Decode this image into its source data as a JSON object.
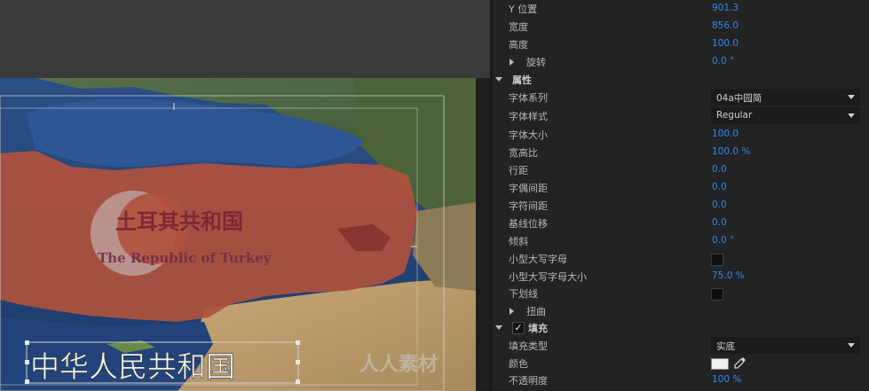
{
  "watermark": "人人素材",
  "map": {
    "title_cn": "土耳其共和国",
    "title_en": "The Republic of Turkey",
    "caption": "中华人民共和国"
  },
  "properties": {
    "y_position": {
      "label": "Y 位置",
      "value": "901.3"
    },
    "width": {
      "label": "宽度",
      "value": "856.0"
    },
    "height": {
      "label": "高度",
      "value": "100.0"
    },
    "rotation": {
      "label": "旋转",
      "value": "0.0 °"
    },
    "attributes_section": {
      "label": "属性"
    },
    "font_family": {
      "label": "字体系列",
      "value": "04a中园简"
    },
    "font_style": {
      "label": "字体样式",
      "value": "Regular"
    },
    "font_size": {
      "label": "字体大小",
      "value": "100.0"
    },
    "aspect": {
      "label": "宽高比",
      "value": "100.0 %"
    },
    "leading": {
      "label": "行距",
      "value": "0.0"
    },
    "kerning": {
      "label": "字偶间距",
      "value": "0.0"
    },
    "tracking": {
      "label": "字符间距",
      "value": "0.0"
    },
    "baseline_shift": {
      "label": "基线位移",
      "value": "0.0"
    },
    "slant": {
      "label": "倾斜",
      "value": "0.0 °"
    },
    "small_caps": {
      "label": "小型大写字母",
      "checked": false
    },
    "small_caps_size": {
      "label": "小型大写字母大小",
      "value": "75.0 %"
    },
    "underline": {
      "label": "下划线",
      "checked": false
    },
    "distort": {
      "label": "扭曲"
    },
    "fill_section": {
      "label": "填充",
      "checked": true
    },
    "fill_type": {
      "label": "填充类型",
      "value": "实底"
    },
    "color": {
      "label": "颜色",
      "swatch": "#f0f0f0"
    },
    "opacity": {
      "label": "不透明度",
      "value": "100 %"
    }
  },
  "colors": {
    "value_blue": "#2d8ceb",
    "panel_bg": "#232323"
  }
}
